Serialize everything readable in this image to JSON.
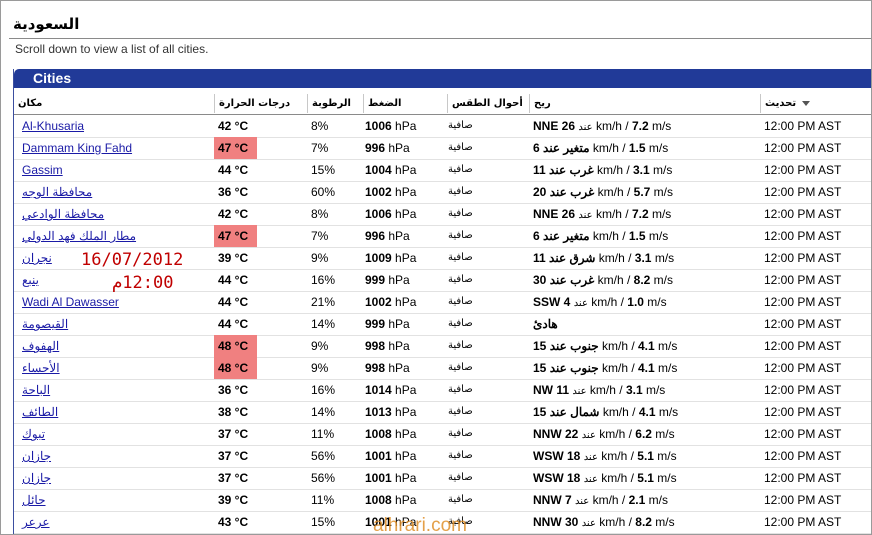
{
  "page": {
    "title": "السعودية",
    "hint": "Scroll down to view a list of all cities.",
    "panel_title": "Cities"
  },
  "columns": {
    "city": "مكان",
    "temp": "درجات الحرارة",
    "humidity": "الرطوبة",
    "pressure": "الضغط",
    "weather": "أحوال الطقس",
    "wind": "ريح",
    "updated": "تحديث"
  },
  "overlay": {
    "date": "16/07/2012",
    "time": "12:00م"
  },
  "watermark": "alhrari.com",
  "colors": {
    "header_bg": "#213a98",
    "hot_cell": "#f08080",
    "link": "#1a1aa6",
    "overlay": "#c00000"
  },
  "icons": {
    "sort": "sort-down-icon"
  },
  "rows": [
    {
      "city": "Al-Khusaria",
      "temp": "42 °C",
      "hot": false,
      "humidity": "8%",
      "pressure_val": "1006",
      "pressure_unit": " hPa",
      "weather": "صافية",
      "wind_dir": "NNE 26",
      "wind_mid": " km/h / ",
      "wind_kmh": "عند",
      "wind_ms": "7.2",
      "wind_unit": " m/s",
      "updated": "12:00 PM AST"
    },
    {
      "city": "Dammam King Fahd",
      "temp": "47 °C",
      "hot": true,
      "humidity": "7%",
      "pressure_val": "996",
      "pressure_unit": " hPa",
      "weather": "صافية",
      "wind_dir": "6 متغير عند",
      "wind_mid": " km/h / ",
      "wind_kmh": "",
      "wind_ms": "1.5",
      "wind_unit": " m/s",
      "updated": "12:00 PM AST"
    },
    {
      "city": "Gassim",
      "temp": "44 °C",
      "hot": false,
      "humidity": "15%",
      "pressure_val": "1004",
      "pressure_unit": " hPa",
      "weather": "صافية",
      "wind_dir": "11 غرب عند",
      "wind_mid": " km/h / ",
      "wind_kmh": "",
      "wind_ms": "3.1",
      "wind_unit": " m/s",
      "updated": "12:00 PM AST"
    },
    {
      "city": "محافظة الوجه",
      "temp": "36 °C",
      "hot": false,
      "humidity": "60%",
      "pressure_val": "1002",
      "pressure_unit": " hPa",
      "weather": "صافية",
      "wind_dir": "20 غرب عند",
      "wind_mid": " km/h / ",
      "wind_kmh": "",
      "wind_ms": "5.7",
      "wind_unit": " m/s",
      "updated": "12:00 PM AST"
    },
    {
      "city": "محافظة الوادعي",
      "temp": "42 °C",
      "hot": false,
      "humidity": "8%",
      "pressure_val": "1006",
      "pressure_unit": " hPa",
      "weather": "صافية",
      "wind_dir": "NNE 26",
      "wind_mid": " km/h / ",
      "wind_kmh": "عند",
      "wind_ms": "7.2",
      "wind_unit": " m/s",
      "updated": "12:00 PM AST"
    },
    {
      "city": "مطار الملك فهد الدولي",
      "temp": "47 °C",
      "hot": true,
      "humidity": "7%",
      "pressure_val": "996",
      "pressure_unit": " hPa",
      "weather": "صافية",
      "wind_dir": "6 متغير عند",
      "wind_mid": " km/h / ",
      "wind_kmh": "",
      "wind_ms": "1.5",
      "wind_unit": " m/s",
      "updated": "12:00 PM AST"
    },
    {
      "city": "نجران",
      "temp": "39 °C",
      "hot": false,
      "humidity": "9%",
      "pressure_val": "1009",
      "pressure_unit": " hPa",
      "weather": "صافية",
      "wind_dir": "11 شرق عند",
      "wind_mid": " km/h / ",
      "wind_kmh": "",
      "wind_ms": "3.1",
      "wind_unit": " m/s",
      "updated": "12:00 PM AST"
    },
    {
      "city": "ينبع",
      "temp": "44 °C",
      "hot": false,
      "humidity": "16%",
      "pressure_val": "999",
      "pressure_unit": " hPa",
      "weather": "صافية",
      "wind_dir": "30 غرب عند",
      "wind_mid": " km/h / ",
      "wind_kmh": "",
      "wind_ms": "8.2",
      "wind_unit": " m/s",
      "updated": "12:00 PM AST"
    },
    {
      "city": "Wadi Al Dawasser",
      "temp": "44 °C",
      "hot": false,
      "humidity": "21%",
      "pressure_val": "1002",
      "pressure_unit": " hPa",
      "weather": "صافية",
      "wind_dir": "SSW 4",
      "wind_mid": " km/h / ",
      "wind_kmh": "عند",
      "wind_ms": "1.0",
      "wind_unit": " m/s",
      "updated": "12:00 PM AST"
    },
    {
      "city": "القيصومة",
      "temp": "44 °C",
      "hot": false,
      "humidity": "14%",
      "pressure_val": "999",
      "pressure_unit": " hPa",
      "weather": "صافية",
      "wind_dir": "هادئ",
      "wind_mid": "",
      "wind_kmh": "",
      "wind_ms": "",
      "wind_unit": "",
      "updated": "12:00 PM AST"
    },
    {
      "city": "الهفوف",
      "temp": "48 °C",
      "hot": true,
      "humidity": "9%",
      "pressure_val": "998",
      "pressure_unit": " hPa",
      "weather": "صافية",
      "wind_dir": "15 جنوب عند",
      "wind_mid": " km/h / ",
      "wind_kmh": "",
      "wind_ms": "4.1",
      "wind_unit": " m/s",
      "updated": "12:00 PM AST"
    },
    {
      "city": "الأحساء",
      "temp": "48 °C",
      "hot": true,
      "humidity": "9%",
      "pressure_val": "998",
      "pressure_unit": " hPa",
      "weather": "صافية",
      "wind_dir": "15 جنوب عند",
      "wind_mid": " km/h / ",
      "wind_kmh": "",
      "wind_ms": "4.1",
      "wind_unit": " m/s",
      "updated": "12:00 PM AST"
    },
    {
      "city": "الباحة",
      "temp": "36 °C",
      "hot": false,
      "humidity": "16%",
      "pressure_val": "1014",
      "pressure_unit": " hPa",
      "weather": "صافية",
      "wind_dir": "NW 11",
      "wind_mid": " km/h / ",
      "wind_kmh": "عند",
      "wind_ms": "3.1",
      "wind_unit": " m/s",
      "updated": "12:00 PM AST"
    },
    {
      "city": "الطائف",
      "temp": "38 °C",
      "hot": false,
      "humidity": "14%",
      "pressure_val": "1013",
      "pressure_unit": " hPa",
      "weather": "صافية",
      "wind_dir": "15 شمال عند",
      "wind_mid": " km/h / ",
      "wind_kmh": "",
      "wind_ms": "4.1",
      "wind_unit": " m/s",
      "updated": "12:00 PM AST"
    },
    {
      "city": "تبوك",
      "temp": "37 °C",
      "hot": false,
      "humidity": "11%",
      "pressure_val": "1008",
      "pressure_unit": " hPa",
      "weather": "صافية",
      "wind_dir": "NNW 22",
      "wind_mid": " km/h / ",
      "wind_kmh": "عند",
      "wind_ms": "6.2",
      "wind_unit": " m/s",
      "updated": "12:00 PM AST"
    },
    {
      "city": "جازان",
      "temp": "37 °C",
      "hot": false,
      "humidity": "56%",
      "pressure_val": "1001",
      "pressure_unit": " hPa",
      "weather": "صافية",
      "wind_dir": "WSW 18",
      "wind_mid": " km/h / ",
      "wind_kmh": "عند",
      "wind_ms": "5.1",
      "wind_unit": " m/s",
      "updated": "12:00 PM AST"
    },
    {
      "city": "جازان",
      "temp": "37 °C",
      "hot": false,
      "humidity": "56%",
      "pressure_val": "1001",
      "pressure_unit": " hPa",
      "weather": "صافية",
      "wind_dir": "WSW 18",
      "wind_mid": " km/h / ",
      "wind_kmh": "عند",
      "wind_ms": "5.1",
      "wind_unit": " m/s",
      "updated": "12:00 PM AST"
    },
    {
      "city": "حائل",
      "temp": "39 °C",
      "hot": false,
      "humidity": "11%",
      "pressure_val": "1008",
      "pressure_unit": " hPa",
      "weather": "صافية",
      "wind_dir": "NNW 7",
      "wind_mid": " km/h / ",
      "wind_kmh": "عند",
      "wind_ms": "2.1",
      "wind_unit": " m/s",
      "updated": "12:00 PM AST"
    },
    {
      "city": "عرعر",
      "temp": "43 °C",
      "hot": false,
      "humidity": "15%",
      "pressure_val": "1001",
      "pressure_unit": " hPa",
      "weather": "صافية",
      "wind_dir": "NNW 30",
      "wind_mid": " km/h / ",
      "wind_kmh": "عند",
      "wind_ms": "8.2",
      "wind_unit": " m/s",
      "updated": "12:00 PM AST"
    }
  ]
}
